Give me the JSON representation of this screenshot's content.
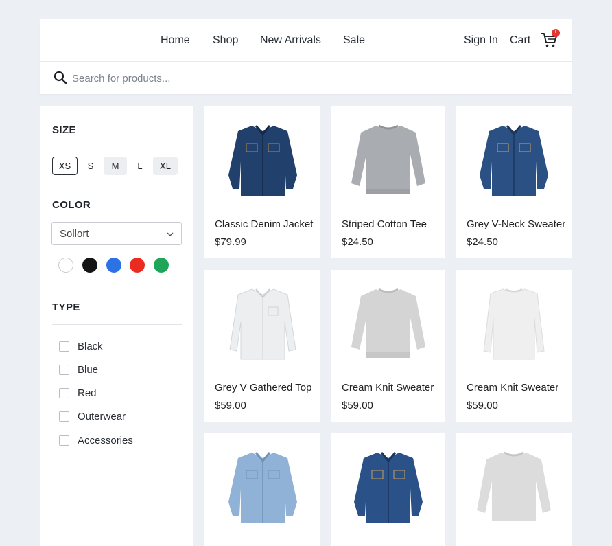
{
  "nav": {
    "links": [
      "Home",
      "Shop",
      "New Arrivals",
      "Sale"
    ],
    "sign_in": "Sign In",
    "cart": "Cart",
    "cart_badge": "!"
  },
  "search": {
    "placeholder": "Search for products..."
  },
  "filters": {
    "size": {
      "title": "SIZE",
      "options": [
        "XS",
        "S",
        "M",
        "L",
        "XL"
      ],
      "selected": "XS"
    },
    "color": {
      "title": "COLOR",
      "select_value": "Sollort",
      "swatches": [
        {
          "name": "white",
          "hex": "#ffffff"
        },
        {
          "name": "black",
          "hex": "#151515"
        },
        {
          "name": "blue",
          "hex": "#2c72e4"
        },
        {
          "name": "red",
          "hex": "#ea2b22"
        },
        {
          "name": "green",
          "hex": "#1fa55a"
        }
      ]
    },
    "type": {
      "title": "TYPE",
      "options": [
        "Black",
        "Blue",
        "Red",
        "Outerwear",
        "Accessories"
      ]
    }
  },
  "products": [
    {
      "name": "Classic Denim Jacket",
      "price": "$79.99",
      "garment": "denim-shirt-dark-icon",
      "color": "#21406b"
    },
    {
      "name": "Striped Cotton Tee",
      "price": "$24.50",
      "garment": "sweater-grey-icon",
      "color": "#a9acb1"
    },
    {
      "name": "Grey V-Neck Sweater",
      "price": "$24.50",
      "garment": "denim-shirt-mid-icon",
      "color": "#2b5184"
    },
    {
      "name": "Grey V Gathered Top",
      "price": "$59.00",
      "garment": "white-shirt-icon",
      "color": "#eceef0"
    },
    {
      "name": "Cream Knit Sweater",
      "price": "$59.00",
      "garment": "sweater-light-grey-icon",
      "color": "#d3d4d3"
    },
    {
      "name": "Cream Knit Sweater",
      "price": "$59.00",
      "garment": "longsleeve-white-icon",
      "color": "#efefef"
    },
    {
      "name": "",
      "price": "",
      "garment": "denim-shirt-light-icon",
      "color": "#8fb2d6"
    },
    {
      "name": "",
      "price": "",
      "garment": "denim-shirt-mid-icon",
      "color": "#2a5288"
    },
    {
      "name": "",
      "price": "",
      "garment": "sweater-light-grey-icon",
      "color": "#dcdcdc"
    }
  ]
}
